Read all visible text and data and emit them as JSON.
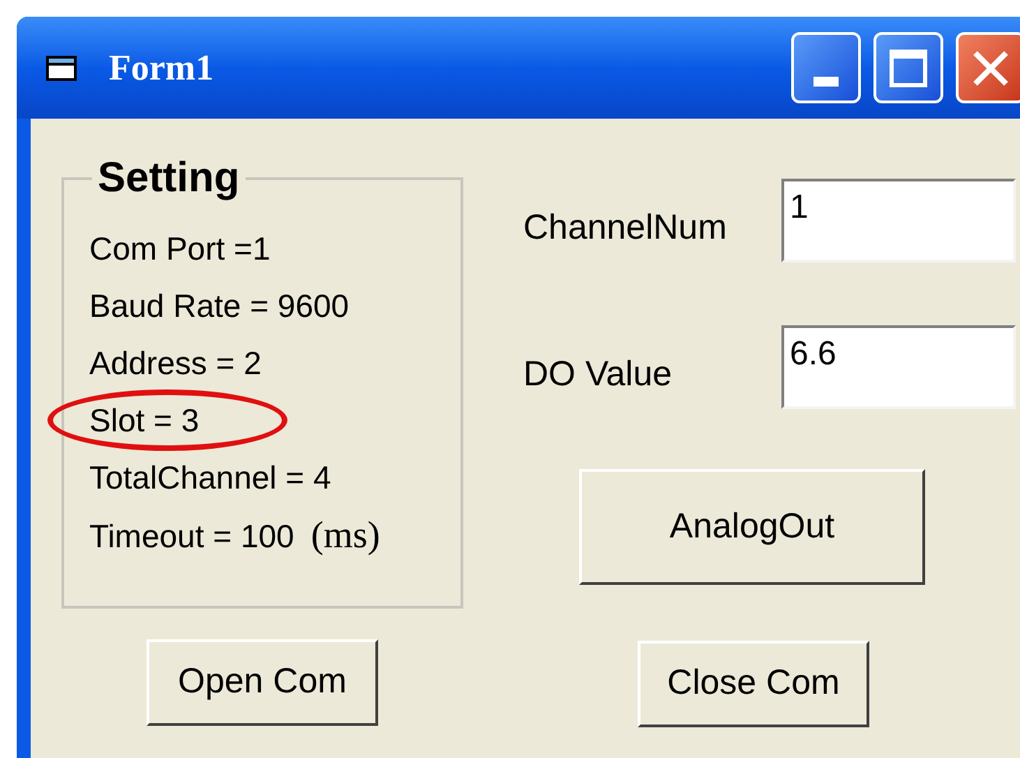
{
  "window": {
    "title": "Form1"
  },
  "setting": {
    "title": "Setting",
    "lines": [
      {
        "text": "Com Port =1",
        "highlighted": false
      },
      {
        "text": "Baud Rate = 9600",
        "highlighted": false
      },
      {
        "text": "Address = 2",
        "highlighted": false
      },
      {
        "text": "Slot = 3",
        "highlighted": true
      },
      {
        "text": "TotalChannel = 4",
        "highlighted": false
      },
      {
        "text": "Timeout = 100",
        "unit": "(ms)",
        "highlighted": false
      }
    ]
  },
  "fields": [
    {
      "label": "ChannelNum",
      "value": "1"
    },
    {
      "label": "DO Value",
      "value": "6.6"
    }
  ],
  "buttons": {
    "analog_out": "AnalogOut",
    "open_com": "Open Com",
    "close_com": "Close Com"
  }
}
